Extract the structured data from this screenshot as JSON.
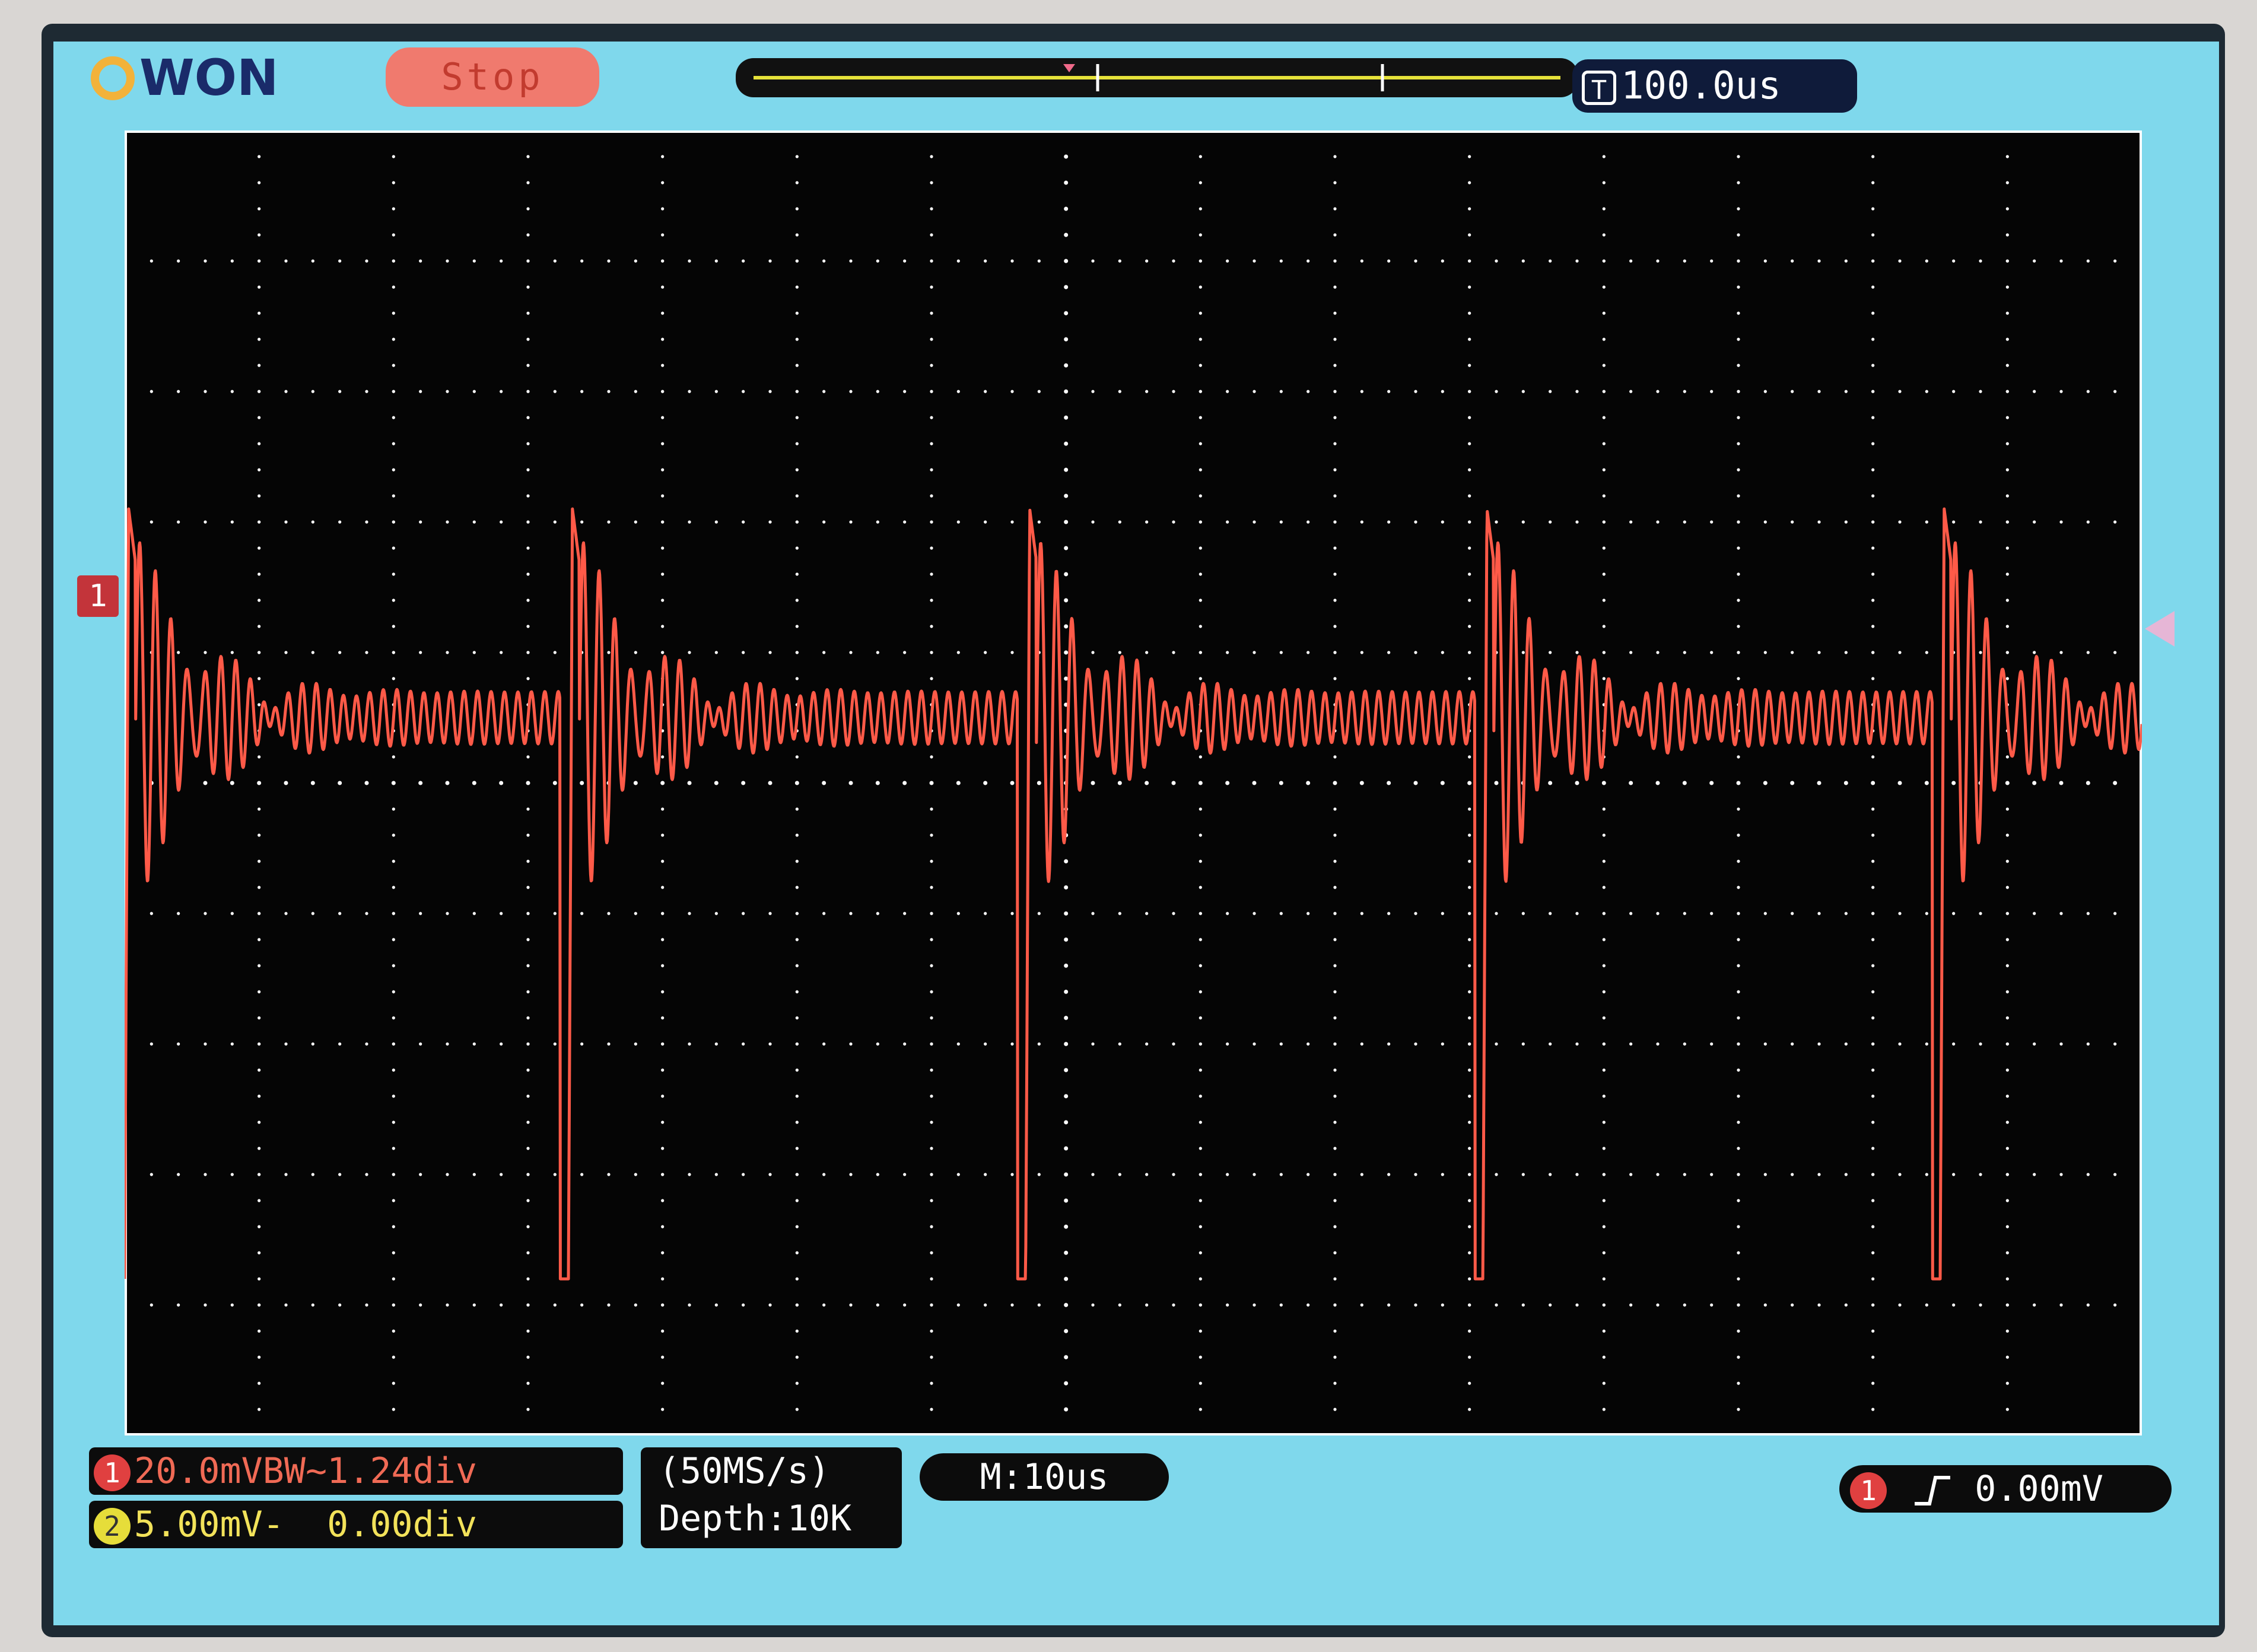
{
  "brand": "OWON",
  "status": {
    "run_state": "Stop"
  },
  "timebase": {
    "icon": "T",
    "value": "100.0us"
  },
  "channel1": {
    "badge": "1",
    "scale": "20.0mV",
    "bandwidth": "BW",
    "offset": "~1.24div",
    "color": "#f06a55"
  },
  "channel2": {
    "badge": "2",
    "scale": "5.00mV",
    "coupling": "-",
    "offset": "0.00div",
    "color": "#f2e25a"
  },
  "acquisition": {
    "sample_rate": "(50MS/s)",
    "depth": "Depth:10K"
  },
  "main_timebase": "M:10us",
  "trigger": {
    "badge": "1",
    "level": "0.00mV",
    "slope_icon": "rising-edge-icon"
  },
  "ch1_marker_label": "1",
  "colors": {
    "screen_bg": "#7fd8ec",
    "plot_bg": "#050505",
    "trace": "#ff5a48",
    "grid": "#ffffff"
  },
  "chart_data": {
    "type": "line",
    "title": "",
    "xlabel": "",
    "ylabel": "",
    "grid": true,
    "divisions": {
      "x": 15,
      "y": 10
    },
    "xlim": [
      0,
      15
    ],
    "ylim": [
      -5,
      5
    ],
    "series": [
      {
        "channel": "1",
        "period_div": 3.4,
        "pulse_starts_div": [
          0.0,
          3.3,
          6.7,
          10.1,
          13.5
        ],
        "pulse_peak_div": 2.1,
        "pulse_trough_div": -3.8,
        "ring_amplitude_div": 1.3,
        "ring_decay_div": 0.45,
        "ripple_amplitude_div": 0.2,
        "ripple_period_div": 0.1,
        "baseline_div": 0.5
      }
    ]
  }
}
